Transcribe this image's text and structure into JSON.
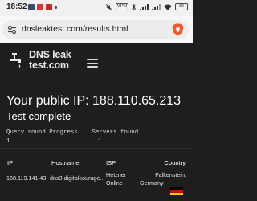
{
  "status_bar": {
    "time": "18:52",
    "vpn_label": "VPN",
    "battery": "89"
  },
  "browser": {
    "url": "dnsleaktest.com/results.html"
  },
  "site": {
    "logo_line1": "DNS leak",
    "logo_line2": "test.com"
  },
  "results": {
    "ip_heading": "Your public IP: 188.110.65.213",
    "status_heading": "Test complete",
    "query_table": {
      "headers": [
        "Query round",
        "Progress...",
        "Servers found"
      ],
      "row": [
        "1",
        "......",
        "1"
      ]
    },
    "server_table": {
      "headers": [
        "IP",
        "Hostname",
        "ISP",
        "Country"
      ],
      "rows": [
        {
          "ip": "168.119.141.43",
          "hostname": "dns3.digitalcourage...",
          "isp_line1": "Hetzner",
          "isp_line2": "Online",
          "country_line1": "Falkenstein,",
          "country_line2": "Germany",
          "flag_colors": [
            "#000000",
            "#dd0000",
            "#ffce00"
          ]
        }
      ]
    }
  }
}
